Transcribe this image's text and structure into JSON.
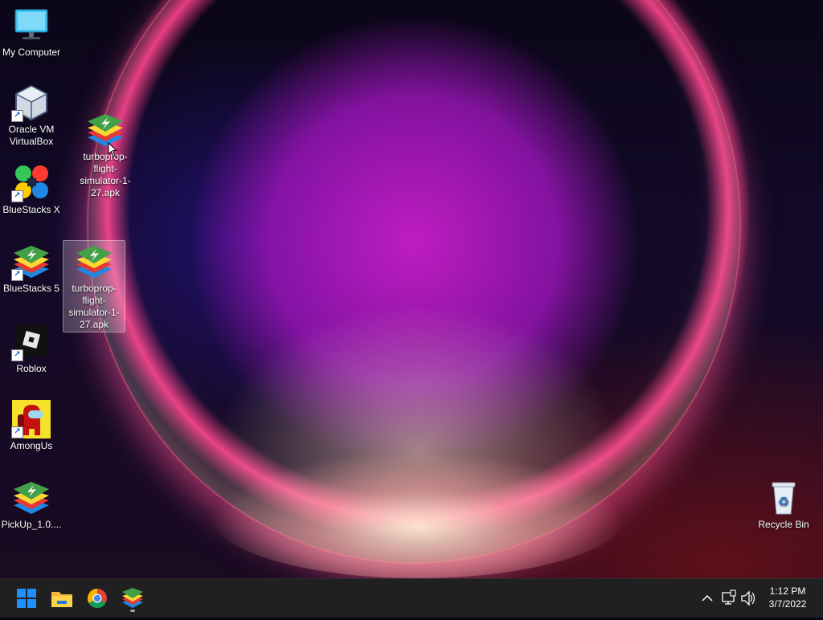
{
  "desktop": {
    "icons": [
      {
        "name": "my-computer",
        "label": "My Computer"
      },
      {
        "name": "oracle-vm-virtualbox",
        "label": "Oracle VM VirtualBox"
      },
      {
        "name": "bluestacks-x",
        "label": "BlueStacks X"
      },
      {
        "name": "bluestacks-5",
        "label": "BlueStacks 5"
      },
      {
        "name": "roblox",
        "label": "Roblox"
      },
      {
        "name": "amongus",
        "label": "AmongUs"
      },
      {
        "name": "pickup",
        "label": "PickUp_1.0...."
      },
      {
        "name": "turboprop-apk-dragged",
        "label": "turboprop-flight-simulator-1-27.apk"
      },
      {
        "name": "turboprop-apk-selected",
        "label": "turboprop-flight-simulator-1-27.apk"
      },
      {
        "name": "recycle-bin",
        "label": "Recycle Bin"
      }
    ]
  },
  "taskbar": {
    "apps": [
      {
        "name": "start-button",
        "icon": "windows-logo"
      },
      {
        "name": "file-explorer",
        "icon": "folder-icon"
      },
      {
        "name": "chrome",
        "icon": "chrome-icon"
      },
      {
        "name": "bluestacks",
        "icon": "bluestacks-icon"
      }
    ],
    "tray": {
      "chevron": "^",
      "time": "1:12 PM",
      "date": "3/7/2022"
    }
  },
  "colors": {
    "taskbar_bg": "#202020",
    "accent_blue": "#1e90ff"
  }
}
